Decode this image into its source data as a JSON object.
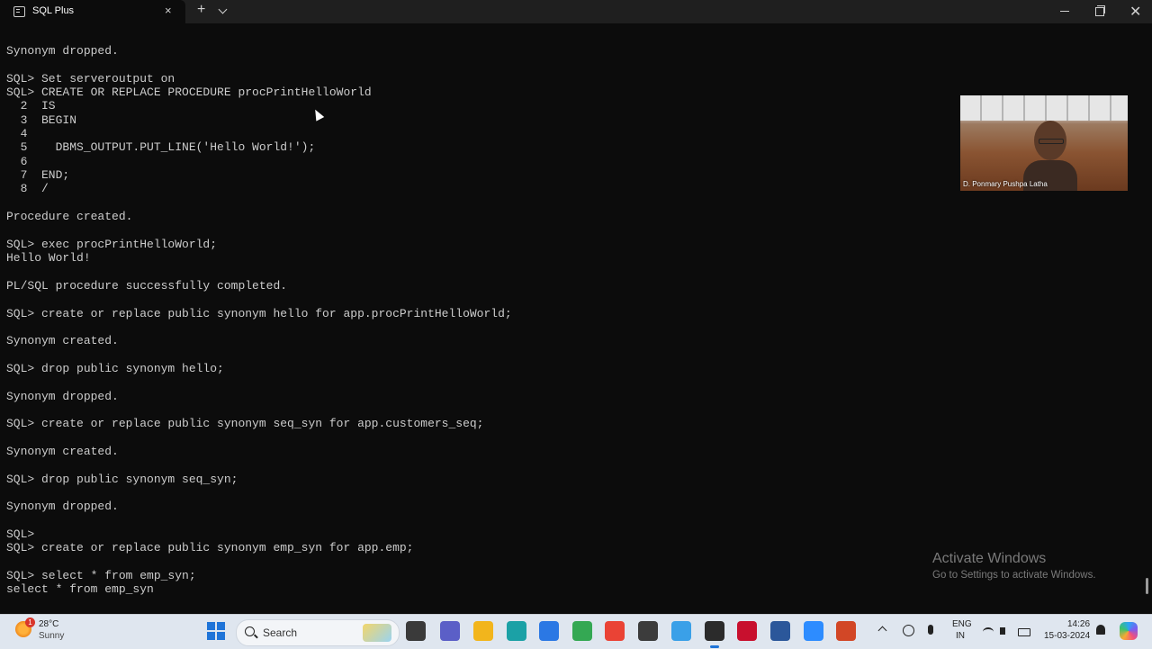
{
  "window": {
    "tab_title": "SQL Plus",
    "close_tab_glyph": "×",
    "new_tab_glyph": "+",
    "close_window_glyph": "✕"
  },
  "terminal": {
    "lines": [
      "Synonym dropped.",
      "",
      "SQL> Set serveroutput on",
      "SQL> CREATE OR REPLACE PROCEDURE procPrintHelloWorld",
      "  2  IS",
      "  3  BEGIN",
      "  4",
      "  5    DBMS_OUTPUT.PUT_LINE('Hello World!');",
      "  6",
      "  7  END;",
      "  8  /",
      "",
      "Procedure created.",
      "",
      "SQL> exec procPrintHelloWorld;",
      "Hello World!",
      "",
      "PL/SQL procedure successfully completed.",
      "",
      "SQL> create or replace public synonym hello for app.procPrintHelloWorld;",
      "",
      "Synonym created.",
      "",
      "SQL> drop public synonym hello;",
      "",
      "Synonym dropped.",
      "",
      "SQL> create or replace public synonym seq_syn for app.customers_seq;",
      "",
      "Synonym created.",
      "",
      "SQL> drop public synonym seq_syn;",
      "",
      "Synonym dropped.",
      "",
      "SQL>",
      "SQL> create or replace public synonym emp_syn for app.emp;",
      "",
      "SQL> select * from emp_syn;",
      "select * from emp_syn"
    ]
  },
  "webcam": {
    "name": "D. Ponmary Pushpa Latha"
  },
  "watermark": {
    "title": "Activate Windows",
    "subtitle": "Go to Settings to activate Windows."
  },
  "taskbar": {
    "weather_temp": "28°C",
    "weather_condition": "Sunny",
    "weather_badge": "1",
    "search_label": "Search",
    "apps": [
      {
        "name": "task-view-icon",
        "color": "#3a3a3a"
      },
      {
        "name": "teams-chat-icon",
        "color": "#5b5fc7"
      },
      {
        "name": "file-explorer-icon",
        "color": "#f2b51c"
      },
      {
        "name": "edge-icon",
        "color": "#1ba1a6"
      },
      {
        "name": "store-icon",
        "color": "#2b78e4"
      },
      {
        "name": "google-drive-icon",
        "color": "#34a853"
      },
      {
        "name": "chrome-icon",
        "color": "#ea4335"
      },
      {
        "name": "sticky-notes-icon",
        "color": "#3c3c3c"
      },
      {
        "name": "notepad-icon",
        "color": "#3aa0e8"
      },
      {
        "name": "terminal-icon",
        "color": "#2b2b2b"
      },
      {
        "name": "mcafee-icon",
        "color": "#c8102e"
      },
      {
        "name": "word-icon",
        "color": "#2b579a"
      },
      {
        "name": "zoom-icon",
        "color": "#2d8cff"
      },
      {
        "name": "powerpoint-icon",
        "color": "#d24726"
      }
    ],
    "lang_line1": "ENG",
    "lang_line2": "IN",
    "time": "14:26",
    "date": "15-03-2024"
  }
}
